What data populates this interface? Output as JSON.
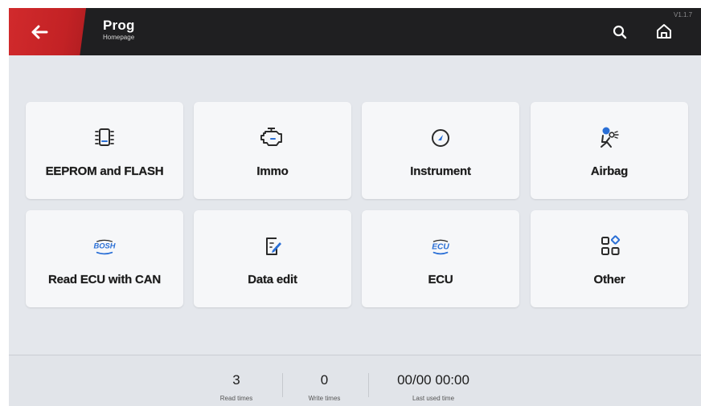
{
  "header": {
    "title": "Prog",
    "subtitle": "Homepage",
    "version": "V1.1.7"
  },
  "icons": {
    "back": "arrow-left-icon",
    "search": "search-icon",
    "home": "home-icon"
  },
  "tiles": [
    {
      "label": "EEPROM and FLASH",
      "icon": "chip-icon"
    },
    {
      "label": "Immo",
      "icon": "engine-icon"
    },
    {
      "label": "Instrument",
      "icon": "gauge-icon"
    },
    {
      "label": "Airbag",
      "icon": "airbag-seat-icon"
    },
    {
      "label": "Read ECU with CAN",
      "icon": "bosh-icon",
      "icon_text": "BOSH"
    },
    {
      "label": "Data edit",
      "icon": "edit-document-icon"
    },
    {
      "label": "ECU",
      "icon": "ecu-icon",
      "icon_text": "ECU"
    },
    {
      "label": "Other",
      "icon": "grid-shapes-icon"
    }
  ],
  "footer": {
    "read_times": {
      "value": "3",
      "label": "Read times"
    },
    "write_times": {
      "value": "0",
      "label": "Write times"
    },
    "last_used": {
      "value": "00/00 00:00",
      "label": "Last used time"
    }
  },
  "colors": {
    "accent_red": "#c8262a",
    "icon_blue": "#2a6fd6",
    "topbar": "#1f1f21",
    "background": "#e4e7ec"
  }
}
